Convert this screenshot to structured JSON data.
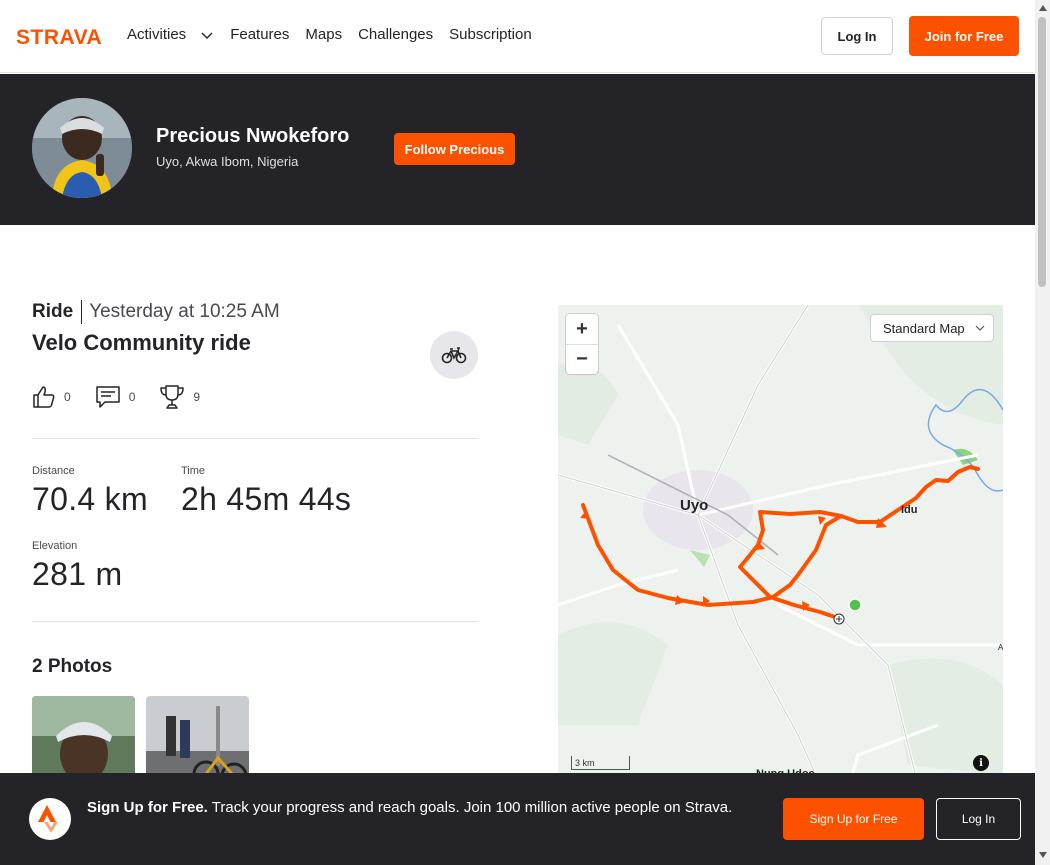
{
  "nav": {
    "brand": "STRAVA",
    "links": [
      "Activities",
      "Features",
      "Maps",
      "Challenges",
      "Subscription"
    ],
    "login_label": "Log In",
    "join_label": "Join for Free"
  },
  "athlete": {
    "name": "Precious Nwokeforo",
    "location": "Uyo, Akwa Ibom, Nigeria",
    "follow_label": "Follow Precious"
  },
  "activity": {
    "type": "Ride",
    "date": "Yesterday at 10:25 AM",
    "title": "Velo Community ride",
    "kudos_count": "0",
    "comments_count": "0",
    "achievements_count": "9"
  },
  "stats": {
    "distance": {
      "label": "Distance",
      "value": "70.4 km"
    },
    "time": {
      "label": "Time",
      "value": "2h 45m 44s"
    },
    "elevation": {
      "label": "Elevation",
      "value": "281 m"
    }
  },
  "photos": {
    "title": "2 Photos"
  },
  "map": {
    "style_label": "Standard Map",
    "zoom_in": "+",
    "zoom_out": "−",
    "scale_label": "3 km",
    "place_uyo": "Uyo",
    "place_idu": "Idu",
    "place_nung": "Nung Udoe",
    "place_edge": "A",
    "info": "i"
  },
  "banner": {
    "headline": "Sign Up for Free.",
    "text": "Track your progress and reach goals. Join 100 million active people on Strava.",
    "signup_label": "Sign Up for Free",
    "login_label": "Log In"
  },
  "colors": {
    "brand": "#fc5200",
    "dark": "#242428",
    "route": "#fc5200",
    "start": "#4cc44c"
  }
}
